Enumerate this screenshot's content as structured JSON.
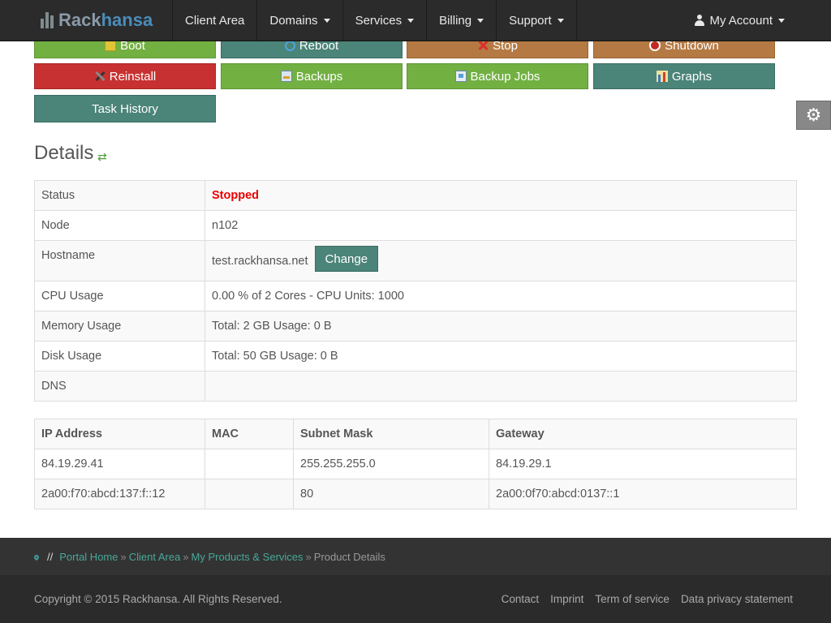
{
  "nav": {
    "logo_rack": "Rack",
    "logo_hansa": "hansa",
    "items": [
      "Client Area",
      "Domains",
      "Services",
      "Billing",
      "Support"
    ],
    "account": "My Account"
  },
  "actions": {
    "boot": "Boot",
    "reboot": "Reboot",
    "stop": "Stop",
    "shutdown": "Shutdown",
    "reinstall": "Reinstall",
    "backups": "Backups",
    "backup_jobs": "Backup Jobs",
    "graphs": "Graphs",
    "task_history": "Task History"
  },
  "details": {
    "title": "Details",
    "status_label": "Status",
    "status_value": "Stopped",
    "node_label": "Node",
    "node_value": "n102",
    "hostname_label": "Hostname",
    "hostname_value": "test.rackhansa.net",
    "change_label": "Change",
    "cpu_label": "CPU Usage",
    "cpu_value": "0.00 % of 2 Cores - CPU Units: 1000",
    "memory_label": "Memory Usage",
    "memory_value": "Total: 2 GB Usage: 0 B",
    "disk_label": "Disk Usage",
    "disk_value": "Total: 50 GB Usage: 0 B",
    "dns_label": "DNS",
    "dns_value": ""
  },
  "ip_table": {
    "headers": [
      "IP Address",
      "MAC",
      "Subnet Mask",
      "Gateway"
    ],
    "rows": [
      [
        "84.19.29.41",
        "",
        "255.255.255.0",
        "84.19.29.1"
      ],
      [
        "2a00:f70:abcd:137:f::12",
        "",
        "80",
        "2a00:0f70:abcd:0137::1"
      ]
    ]
  },
  "breadcrumb": {
    "separator": "//",
    "items": [
      "Portal Home",
      "Client Area",
      "My Products & Services"
    ],
    "current": "Product Details"
  },
  "footer": {
    "copyright": "Copyright © 2015 Rackhansa. All Rights Reserved.",
    "links": [
      "Contact",
      "Imprint",
      "Term of service",
      "Data privacy statement"
    ]
  }
}
